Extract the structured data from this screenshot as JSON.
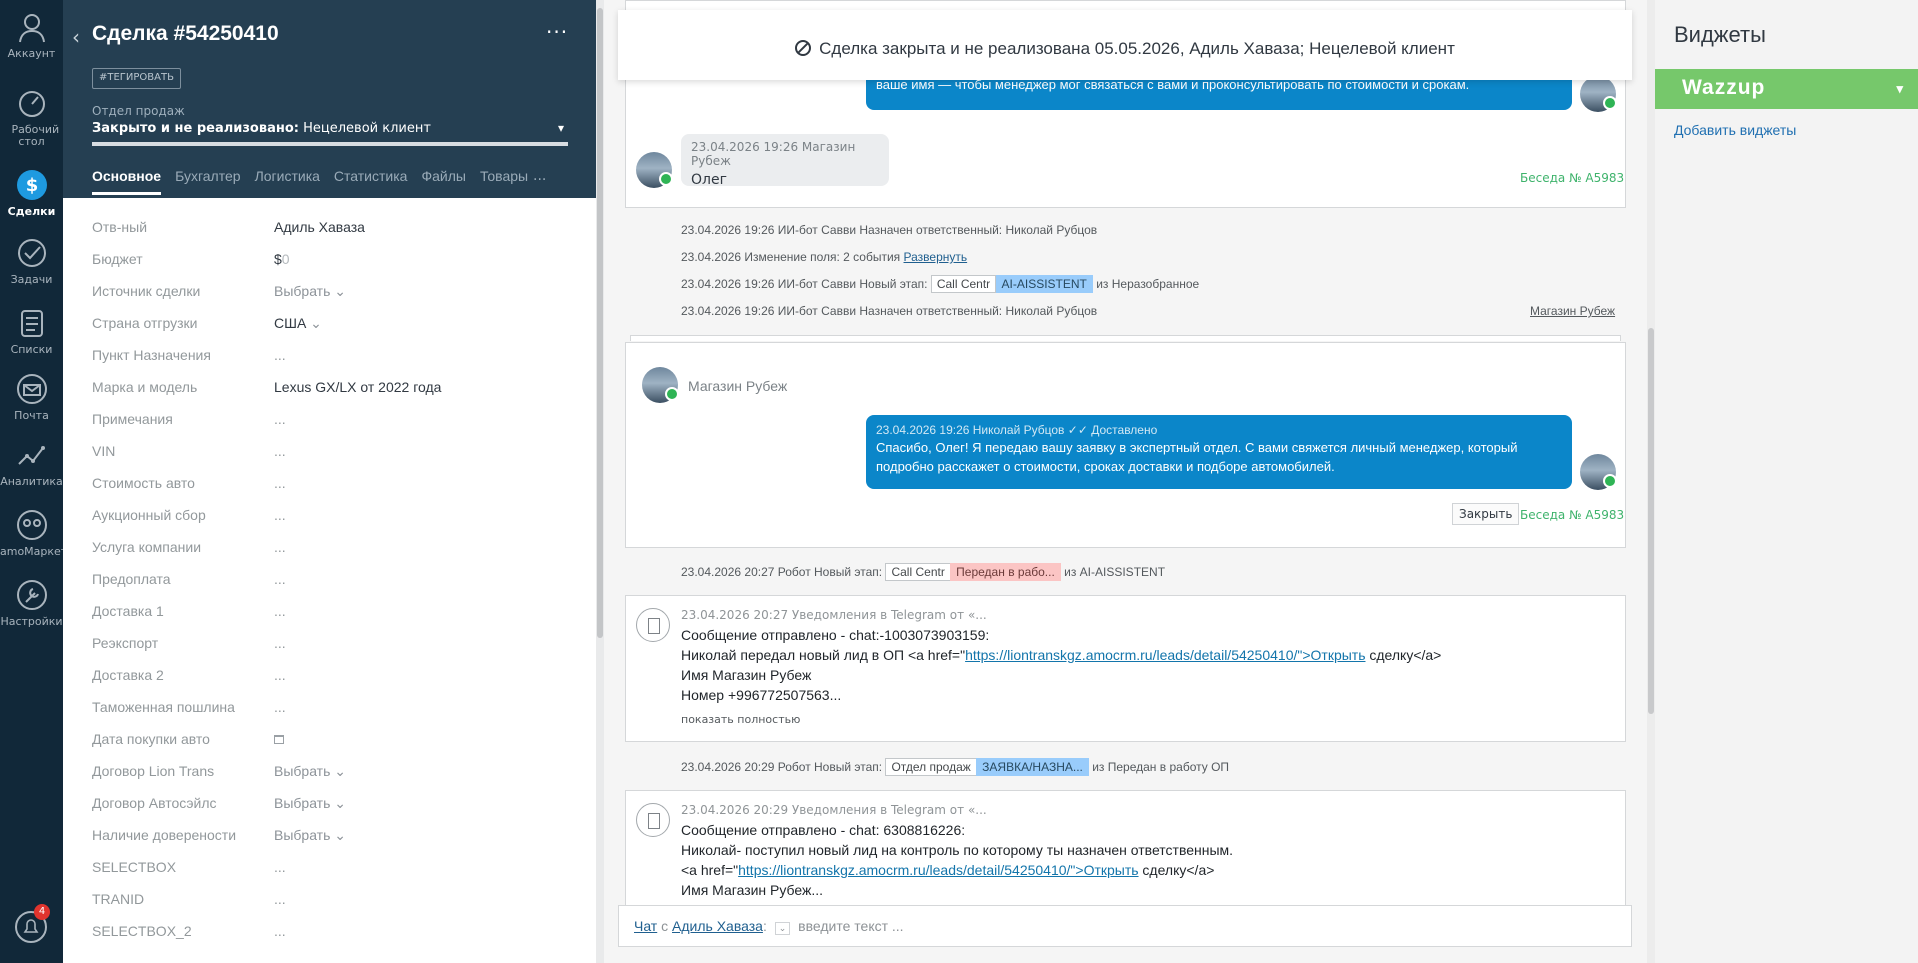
{
  "nav": {
    "items": [
      {
        "label": "Аккаунт",
        "icon": "user-icon"
      },
      {
        "label": "Рабочий стол",
        "icon": "dashboard-icon"
      },
      {
        "label": "Сделки",
        "icon": "deals-icon"
      },
      {
        "label": "Задачи",
        "icon": "tasks-icon"
      },
      {
        "label": "Списки",
        "icon": "lists-icon"
      },
      {
        "label": "Почта",
        "icon": "mail-icon"
      },
      {
        "label": "Аналитика",
        "icon": "analytics-icon"
      },
      {
        "label": "amoМаркет",
        "icon": "market-icon"
      },
      {
        "label": "Настройки",
        "icon": "settings-icon"
      }
    ],
    "notifications_badge": "4"
  },
  "lead": {
    "title": "Сделка #54250410",
    "tag_button": "#ТЕГИРОВАТЬ",
    "pipeline": "Отдел продаж",
    "status_bold": "Закрыто и не реализовано:",
    "status_reason": " Нецелевой клиент",
    "tabs": [
      "Основное",
      "Бухгалтер",
      "Логистика",
      "Статистика",
      "Файлы",
      "Товары"
    ],
    "tabs_more": "...",
    "fields": [
      {
        "label": "Отв-ный",
        "value": "Адиль Хаваза"
      },
      {
        "label": "Бюджет",
        "value": "$",
        "value_muted": "0"
      },
      {
        "label": "Источник сделки",
        "value": "Выбрать"
      },
      {
        "label": "Страна отгрузки",
        "value": "США"
      },
      {
        "label": "Пункт Назначения",
        "value": "..."
      },
      {
        "label": "Марка и модель",
        "value": "Lexus GX/LX от 2022 года"
      },
      {
        "label": "Примечания",
        "value": "..."
      },
      {
        "label": "VIN",
        "value": "..."
      },
      {
        "label": "Стоимость авто",
        "value": "..."
      },
      {
        "label": "Аукционный сбор",
        "value": "..."
      },
      {
        "label": "Услуга компании",
        "value": "..."
      },
      {
        "label": "Предоплата",
        "value": "..."
      },
      {
        "label": "Доставка 1",
        "value": "..."
      },
      {
        "label": "Реэкспорт",
        "value": "..."
      },
      {
        "label": "Доставка 2",
        "value": "..."
      },
      {
        "label": "Таможенная пошлина",
        "value": "..."
      },
      {
        "label": "Дата покупки авто",
        "value": ""
      },
      {
        "label": "Договор Lion Trans",
        "value": "Выбрать"
      },
      {
        "label": "Договор Автосэйлс",
        "value": "Выбрать"
      },
      {
        "label": "Наличие доверености",
        "value": "Выбрать"
      },
      {
        "label": "SELECTBOX",
        "value": "..."
      },
      {
        "label": "TRANID",
        "value": "..."
      },
      {
        "label": "SELECTBOX_2",
        "value": "..."
      }
    ]
  },
  "feed": {
    "closed_banner": "Сделка закрыта и не реализована 05.05.2026, Адиль Хаваза; Нецелевой клиент",
    "top_blue_text": "ваше имя — чтобы менеджер мог связаться с вами и проконсультировать по стоимости и срокам.",
    "msg1_meta": "23.04.2026 19:26 Магазин Рубеж",
    "msg1_text": "Олег",
    "convo_label": "Беседа № A5983",
    "events1": {
      "e1": "23.04.2026 19:26 ИИ-бот Савви Назначен ответственный: Николай Рубцов",
      "e2_prefix": "23.04.2026 Изменение поля: 2 события ",
      "e2_link": "Развернуть",
      "e3_prefix": "23.04.2026 19:26 ИИ-бот Савви Новый этап: ",
      "e3_stage1": "Call Centr",
      "e3_stage2": "AI-AISSISTENT",
      "e3_suffix": " из Неразобранное",
      "e4": "23.04.2026 19:26 ИИ-бот Савви Назначен ответственный: Николай Рубцов",
      "e4_link": "Магазин Рубеж"
    },
    "card2": {
      "sender": "Магазин Рубеж",
      "blue_meta": "23.04.2026 19:26 Николай Рубцов",
      "delivered": "Доставлено",
      "blue_text": "Спасибо, Олег! Я передаю вашу заявку в экспертный отдел. С вами свяжется личный менеджер, который подробно расскажет о стоимости, сроках доставки и подборе автомобилей.",
      "close_button": "Закрыть",
      "convo": "Беседа № A5983"
    },
    "event5": {
      "prefix": "23.04.2026 20:27 Робот Новый этап: ",
      "stage1": "Call Centr",
      "stage2": "Передан в рабо...",
      "suffix": " из AI-AISSISTENT"
    },
    "notif1": {
      "meta": "23.04.2026 20:27 Уведомления в Telegram от «...",
      "line1": "Сообщение отправлено - chat:-1003073903159:",
      "line2_prefix": "Николай передал новый лид в ОП <a href=\"",
      "line2_link": "https://liontranskgz.amocrm.ru/leads/detail/54250410/\">Открыть",
      "line2_suffix": " сделку</a>",
      "line3": "Имя Магазин Рубеж",
      "line4": "Номер +996772507563...",
      "show_full": "показать полностью"
    },
    "event6": {
      "prefix": "23.04.2026 20:29 Робот Новый этап: ",
      "stage1": "Отдел продаж",
      "stage2": "ЗАЯВКА/НАЗНА...",
      "suffix": " из Передан в работу ОП"
    },
    "notif2": {
      "meta": "23.04.2026 20:29 Уведомления в Telegram от «...",
      "line1": "Сообщение отправлено - chat: 6308816226:",
      "line2": "Николай- поступил новый лид на контроль по которому ты назначен ответственным.",
      "line3_prefix": "<a href=\"",
      "line3_link": "https://liontranskgz.amocrm.ru/leads/detail/54250410/\">Открыть",
      "line3_suffix": " сделку</a>",
      "line4": "Имя Магазин Рубеж..."
    },
    "chat_bar": {
      "chat_link": "Чат",
      "with": " с ",
      "user_link": "Адиль Хаваза",
      "colon": ":",
      "placeholder": "введите текст ..."
    }
  },
  "widgets": {
    "title": "Виджеты",
    "wazzup": "Wazzup",
    "add_link": "Добавить виджеты"
  },
  "colors": {
    "nav_bg": "#112839",
    "lead_header_bg": "#253f52",
    "blue_message": "#0b86c9",
    "wazzup_green": "#76c86b",
    "whatsapp_green": "#2fb455"
  }
}
